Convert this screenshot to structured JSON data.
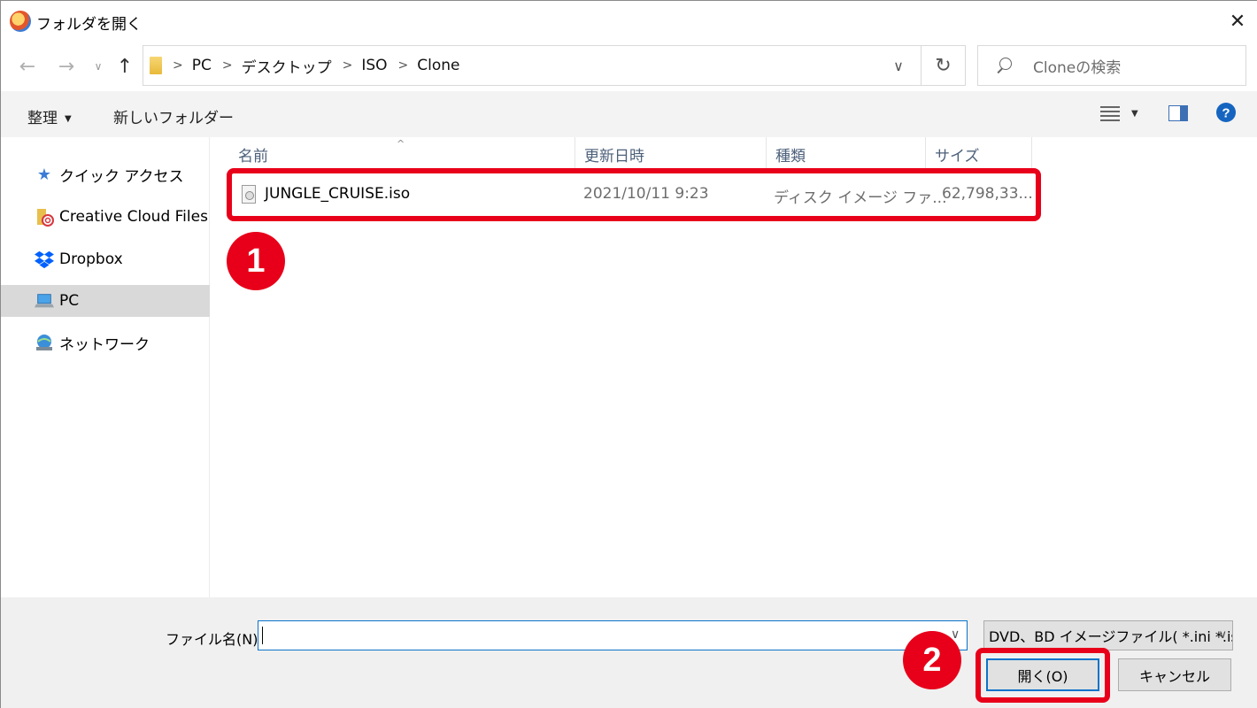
{
  "window": {
    "title": "フォルダを開く"
  },
  "nav": {
    "breadcrumbs": [
      "PC",
      "デスクトップ",
      "ISO",
      "Clone"
    ],
    "search_placeholder": "Cloneの検索"
  },
  "commands": {
    "organize": "整理",
    "new_folder": "新しいフォルダー"
  },
  "sidebar": {
    "items": [
      {
        "label": "クイック アクセス",
        "icon": "star-icon"
      },
      {
        "label": "Creative Cloud Files",
        "icon": "creative-cloud-folder-icon"
      },
      {
        "label": "Dropbox",
        "icon": "dropbox-icon"
      },
      {
        "label": "PC",
        "icon": "computer-icon",
        "selected": true
      },
      {
        "label": "ネットワーク",
        "icon": "network-icon"
      }
    ]
  },
  "columns": {
    "name": "名前",
    "modified": "更新日時",
    "type": "種類",
    "size": "サイズ"
  },
  "files": [
    {
      "name": "JUNGLE_CRUISE.iso",
      "modified": "2021/10/11 9:23",
      "type": "ディスク イメージ ファ...",
      "size": "62,798,33..."
    }
  ],
  "annotations": {
    "badge1": "1",
    "badge2": "2",
    "color": "#e8001a"
  },
  "footer": {
    "filename_label": "ファイル名(N):",
    "filename_value": "",
    "filter": "DVD、BD イメージファイル( *.ini *.is",
    "open_button": "開く(O)",
    "cancel_button": "キャンセル"
  }
}
